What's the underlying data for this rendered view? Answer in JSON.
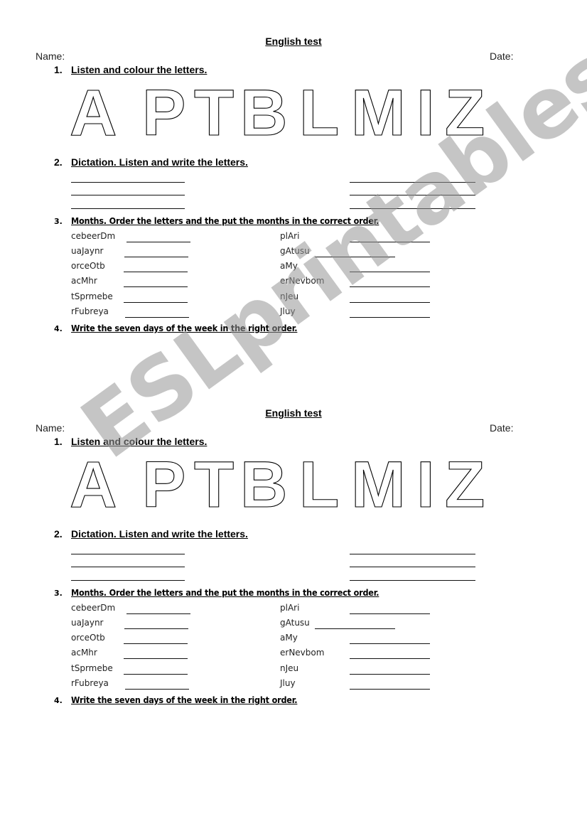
{
  "tests": [
    {
      "title": "English test",
      "name_label": "Name:",
      "date_label": "Date:",
      "q1": {
        "number": "1.",
        "text": "Listen and colour the letters."
      },
      "letters": [
        "A",
        "P",
        "T",
        "B",
        "L",
        "M",
        "I",
        "Z"
      ],
      "q2": {
        "number": "2.",
        "text": "Dictation. Listen and write the letters."
      },
      "q3": {
        "number": "3.",
        "text": "Months. Order the letters and the put the months in the correct order."
      },
      "months_left": [
        "cebeerDm",
        "uaJaynr",
        "orceOtb",
        "acMhr",
        "tSprmebe",
        "rFubreya"
      ],
      "months_right": [
        "plAri",
        "gAtusu",
        "aMy",
        "erNevbom",
        "nJeu",
        "Jluy"
      ],
      "q4": {
        "number": "4.",
        "text": "Write the seven days of the week  in the right order."
      }
    },
    {
      "title": "English test",
      "name_label": "Name:",
      "date_label": "Date:",
      "q1": {
        "number": "1.",
        "text": "Listen and colour the letters."
      },
      "letters": [
        "A",
        "P",
        "T",
        "B",
        "L",
        "M",
        "I",
        "Z"
      ],
      "q2": {
        "number": "2.",
        "text": "Dictation. Listen and write the letters."
      },
      "q3": {
        "number": "3.",
        "text": "Months. Order the letters and the put the months in the correct order."
      },
      "months_left": [
        "cebeerDm",
        "uaJaynr",
        "orceOtb",
        "acMhr",
        "tSprmebe",
        "rFubreya"
      ],
      "months_right": [
        "plAri",
        "gAtusu",
        "aMy",
        "erNevbom",
        "nJeu",
        "Jluy"
      ],
      "q4": {
        "number": "4.",
        "text": "Write the seven days of the week  in the right order."
      }
    }
  ],
  "watermark": "ESLprintables.com"
}
